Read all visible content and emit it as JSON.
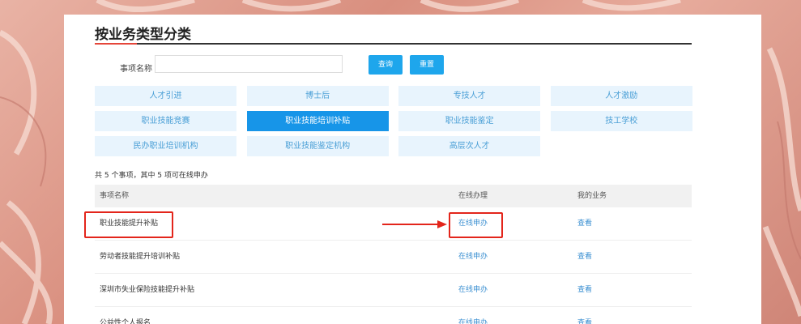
{
  "page": {
    "title": "按业务类型分类"
  },
  "search": {
    "label": "事项名称",
    "value": "",
    "placeholder": "",
    "query_button": "查询",
    "reset_button": "重置"
  },
  "categories": [
    {
      "label": "人才引进",
      "active": false
    },
    {
      "label": "博士后",
      "active": false
    },
    {
      "label": "专技人才",
      "active": false
    },
    {
      "label": "人才激励",
      "active": false
    },
    {
      "label": "职业技能竞赛",
      "active": false
    },
    {
      "label": "职业技能培训补贴",
      "active": true
    },
    {
      "label": "职业技能鉴定",
      "active": false
    },
    {
      "label": "技工学校",
      "active": false
    },
    {
      "label": "民办职业培训机构",
      "active": false
    },
    {
      "label": "职业技能鉴定机构",
      "active": false
    },
    {
      "label": "高层次人才",
      "active": false
    }
  ],
  "summary": "共 5 个事项，其中 5 项可在线申办",
  "table": {
    "headers": [
      "事项名称",
      "在线办理",
      "我的业务"
    ],
    "rows": [
      {
        "name": "职业技能提升补贴",
        "online": "在线申办",
        "mine": "查看"
      },
      {
        "name": "劳动者技能提升培训补贴",
        "online": "在线申办",
        "mine": "查看"
      },
      {
        "name": "深圳市失业保险技能提升补贴",
        "online": "在线申办",
        "mine": "查看"
      },
      {
        "name": "公益性个人报名",
        "online": "在线申办",
        "mine": "查看"
      }
    ]
  },
  "colors": {
    "accent": "#1795e8",
    "title_accent": "#e5463a",
    "annotation": "#e3251b",
    "link": "#3a8fd1"
  }
}
